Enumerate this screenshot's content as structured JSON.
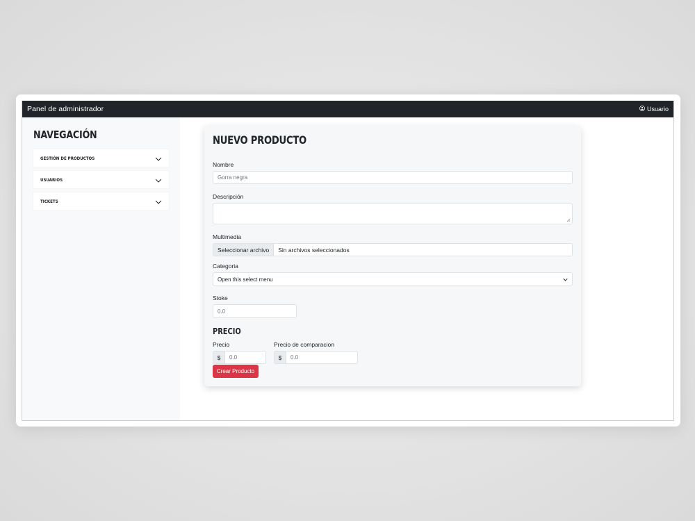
{
  "navbar": {
    "brand": "Panel de administrador",
    "user_label": "Usuario"
  },
  "sidebar": {
    "title": "Navegación",
    "items": [
      {
        "label": "Gestión de productos"
      },
      {
        "label": "Usuarios"
      },
      {
        "label": "Tickets"
      }
    ]
  },
  "form": {
    "title": "Nuevo producto",
    "name": {
      "label": "Nombre",
      "placeholder": "Gorra negra"
    },
    "description": {
      "label": "Descripción",
      "value": ""
    },
    "media": {
      "label": "Multimedia",
      "button": "Seleccionar archivo",
      "status": "Sin archivos seleccionados"
    },
    "category": {
      "label": "Categoria",
      "selected": "Open this select menu"
    },
    "stock": {
      "label": "Stoke",
      "placeholder": "0.0"
    },
    "price_section": {
      "title": "Precio",
      "price": {
        "label": "Precio",
        "currency": "$",
        "placeholder": "0.0"
      },
      "compare": {
        "label": "Precio de comparacion",
        "currency": "$",
        "placeholder": "0.0"
      }
    },
    "submit": "Crear Producto"
  },
  "colors": {
    "navbar": "#212529",
    "sidebar": "#f8f9fa",
    "danger": "#dc3545"
  }
}
